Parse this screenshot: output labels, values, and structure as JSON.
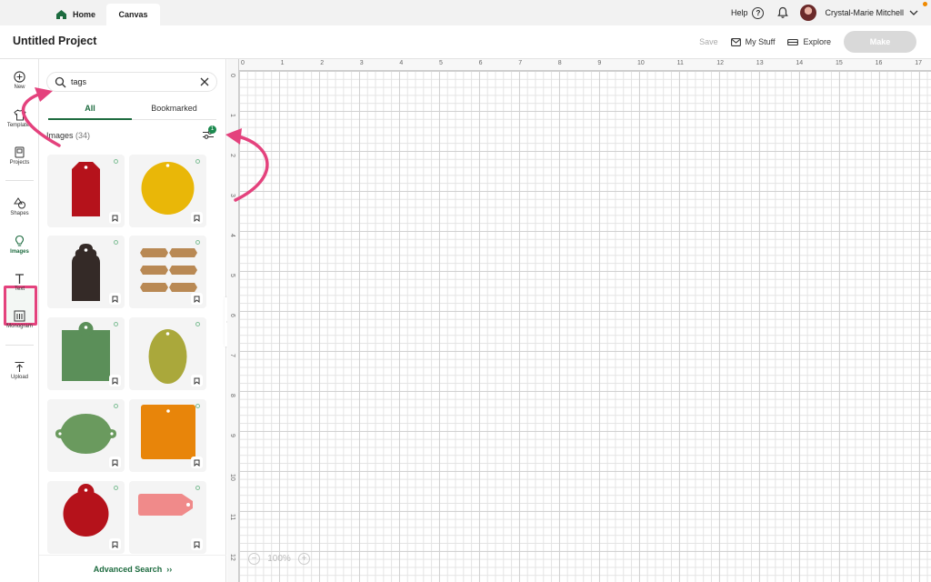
{
  "top_tabs": {
    "home": "Home",
    "canvas": "Canvas"
  },
  "top_right": {
    "help": "Help",
    "user_name": "Crystal-Marie Mitchell"
  },
  "project": {
    "title": "Untitled Project",
    "save": "Save",
    "my_stuff": "My Stuff",
    "explore": "Explore",
    "make": "Make"
  },
  "rail": [
    {
      "label": "New",
      "icon": "plus-circle-icon"
    },
    {
      "label": "Templates",
      "icon": "shirt-icon"
    },
    {
      "label": "Projects",
      "icon": "projects-icon"
    },
    {
      "label": "Shapes",
      "icon": "shapes-icon"
    },
    {
      "label": "Images",
      "icon": "lightbulb-icon",
      "active": true
    },
    {
      "label": "Text",
      "icon": "text-icon"
    },
    {
      "label": "Monogram",
      "icon": "monogram-icon"
    },
    {
      "label": "Upload",
      "icon": "upload-icon"
    }
  ],
  "panel": {
    "search_value": "tags",
    "tab_all": "All",
    "tab_bookmarked": "Bookmarked",
    "images_label": "Images",
    "images_count": "(34)",
    "filter_badge": "1",
    "advanced_search": "Advanced Search",
    "cards": [
      {
        "shape": "tag",
        "color": "#b5121b"
      },
      {
        "shape": "circle",
        "color": "#e9b708"
      },
      {
        "shape": "scalloped-tag",
        "color": "#342a27"
      },
      {
        "shape": "label-set",
        "color": "#b98954"
      },
      {
        "shape": "square-tab",
        "color": "#5b8f59"
      },
      {
        "shape": "oval",
        "color": "#aaa83b"
      },
      {
        "shape": "notched-oval",
        "color": "#6a9a5e"
      },
      {
        "shape": "rounded-square",
        "color": "#e8850a"
      },
      {
        "shape": "circle-tab",
        "color": "#b5121b"
      },
      {
        "shape": "side-tag",
        "color": "#f08a8a"
      }
    ]
  },
  "canvas": {
    "ruler_top": [
      "0",
      "1",
      "2",
      "3",
      "4",
      "5",
      "6",
      "7",
      "8",
      "9",
      "10",
      "11",
      "12",
      "13",
      "14",
      "15",
      "16",
      "17"
    ],
    "ruler_left": [
      "0",
      "1",
      "2",
      "3",
      "4",
      "5",
      "6",
      "7",
      "8",
      "9",
      "10",
      "11",
      "12"
    ],
    "zoom": "100%",
    "grid_color": "#e4e4e4"
  },
  "annotation_color": "#e4427d"
}
